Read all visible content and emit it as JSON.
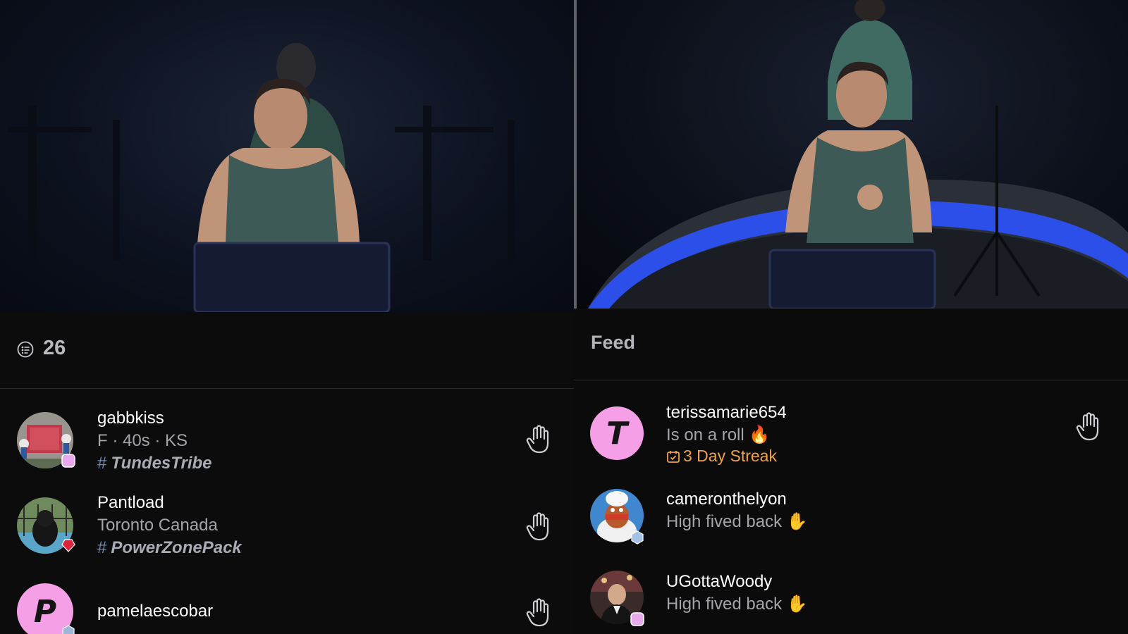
{
  "participants": {
    "count": "26",
    "count_icon": "participants-list-icon",
    "items": [
      {
        "name": "gabbkiss",
        "detail": "F · 40s · KS",
        "tag": "TundesTribe",
        "badge_color": "#e9a9ee",
        "avatar": "photo-sign"
      },
      {
        "name": "Pantload",
        "detail": "Toronto Canada",
        "tag": "PowerZonePack",
        "badge_color": "#e0233a",
        "avatar": "photo-dog"
      },
      {
        "name": "pamelaescobar",
        "initial": "P",
        "badge_color": "#9fb6d6",
        "avatar": "letter"
      }
    ],
    "hand_icon": "high-five-hand-icon"
  },
  "feed": {
    "title": "Feed",
    "items": [
      {
        "name": "terissamarie654",
        "message": "Is on a roll 🔥",
        "streak": "3 Day Streak",
        "initial": "T",
        "avatar": "letter"
      },
      {
        "name": "cameronthelyon",
        "message": "High fived back ✋",
        "avatar": "photo-chef"
      },
      {
        "name": "UGottaWoody",
        "message": "High fived back ✋",
        "avatar": "photo-man"
      }
    ]
  },
  "colors": {
    "accent_streak": "#f0a23c",
    "letter_avatar_bg": "#f49fe6",
    "background": "#0b0b0c"
  }
}
